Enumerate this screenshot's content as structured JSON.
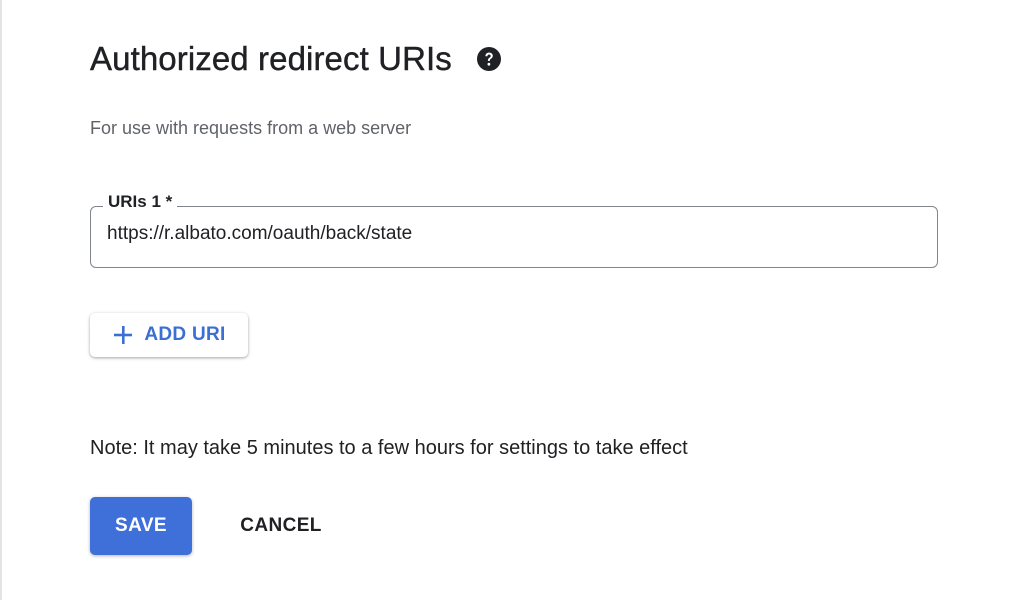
{
  "section": {
    "title": "Authorized redirect URIs",
    "help_icon": "help-circle-icon",
    "subtitle": "For use with requests from a web server"
  },
  "uri_field": {
    "label": "URIs 1 *",
    "value": "https://r.albato.com/oauth/back/state"
  },
  "add_uri": {
    "label": "ADD URI",
    "icon": "plus-icon",
    "color": "#3b6fd4"
  },
  "note": "Note: It may take 5 minutes to a few hours for settings to take effect",
  "actions": {
    "save_label": "SAVE",
    "cancel_label": "CANCEL",
    "primary_color": "#3f6fd8"
  }
}
